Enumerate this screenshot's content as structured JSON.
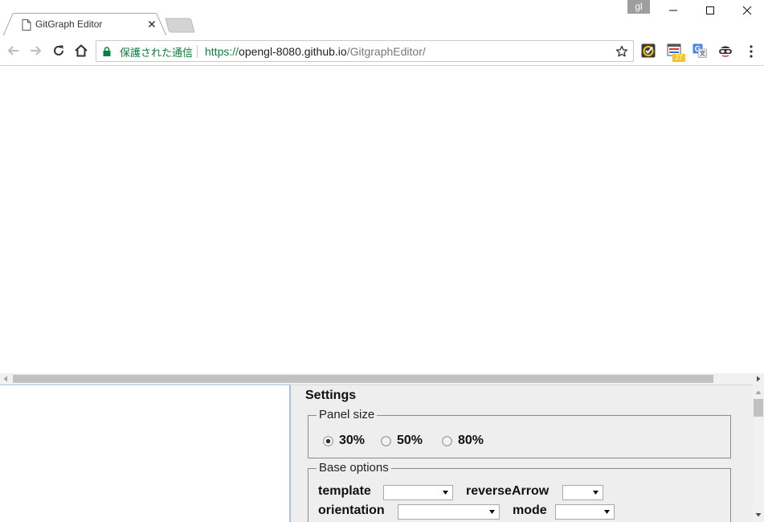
{
  "browser": {
    "tab_title": "GitGraph Editor",
    "profile_badge": "gl",
    "secure_label": "保護された通信",
    "url_scheme": "https://",
    "url_host": "opengl-8080.github.io",
    "url_path": "/GitgraphEditor/",
    "extension_badge": "27",
    "icons": {
      "page": "page-icon",
      "close_tab": "close-icon",
      "back": "back-arrow-icon",
      "forward": "forward-arrow-icon",
      "reload": "reload-icon",
      "home": "home-icon",
      "lock": "lock-icon",
      "bookmark": "star-icon",
      "menu": "more-vert-icon"
    }
  },
  "settings": {
    "title": "Settings",
    "panel_size": {
      "legend": "Panel size",
      "options": [
        "30%",
        "50%",
        "80%"
      ],
      "selected": "30%"
    },
    "base_options": {
      "legend": "Base options",
      "template_label": "template",
      "template_value": "",
      "reverse_arrow_label": "reverseArrow",
      "reverse_arrow_value": "",
      "orientation_label": "orientation",
      "orientation_value": "",
      "mode_label": "mode",
      "mode_value": ""
    }
  },
  "colors": {
    "secure_green": "#0b8043",
    "settings_bg": "#eeeeee",
    "editor_border": "#a9c2dd",
    "scroll_thumb": "#c1c1c1"
  }
}
